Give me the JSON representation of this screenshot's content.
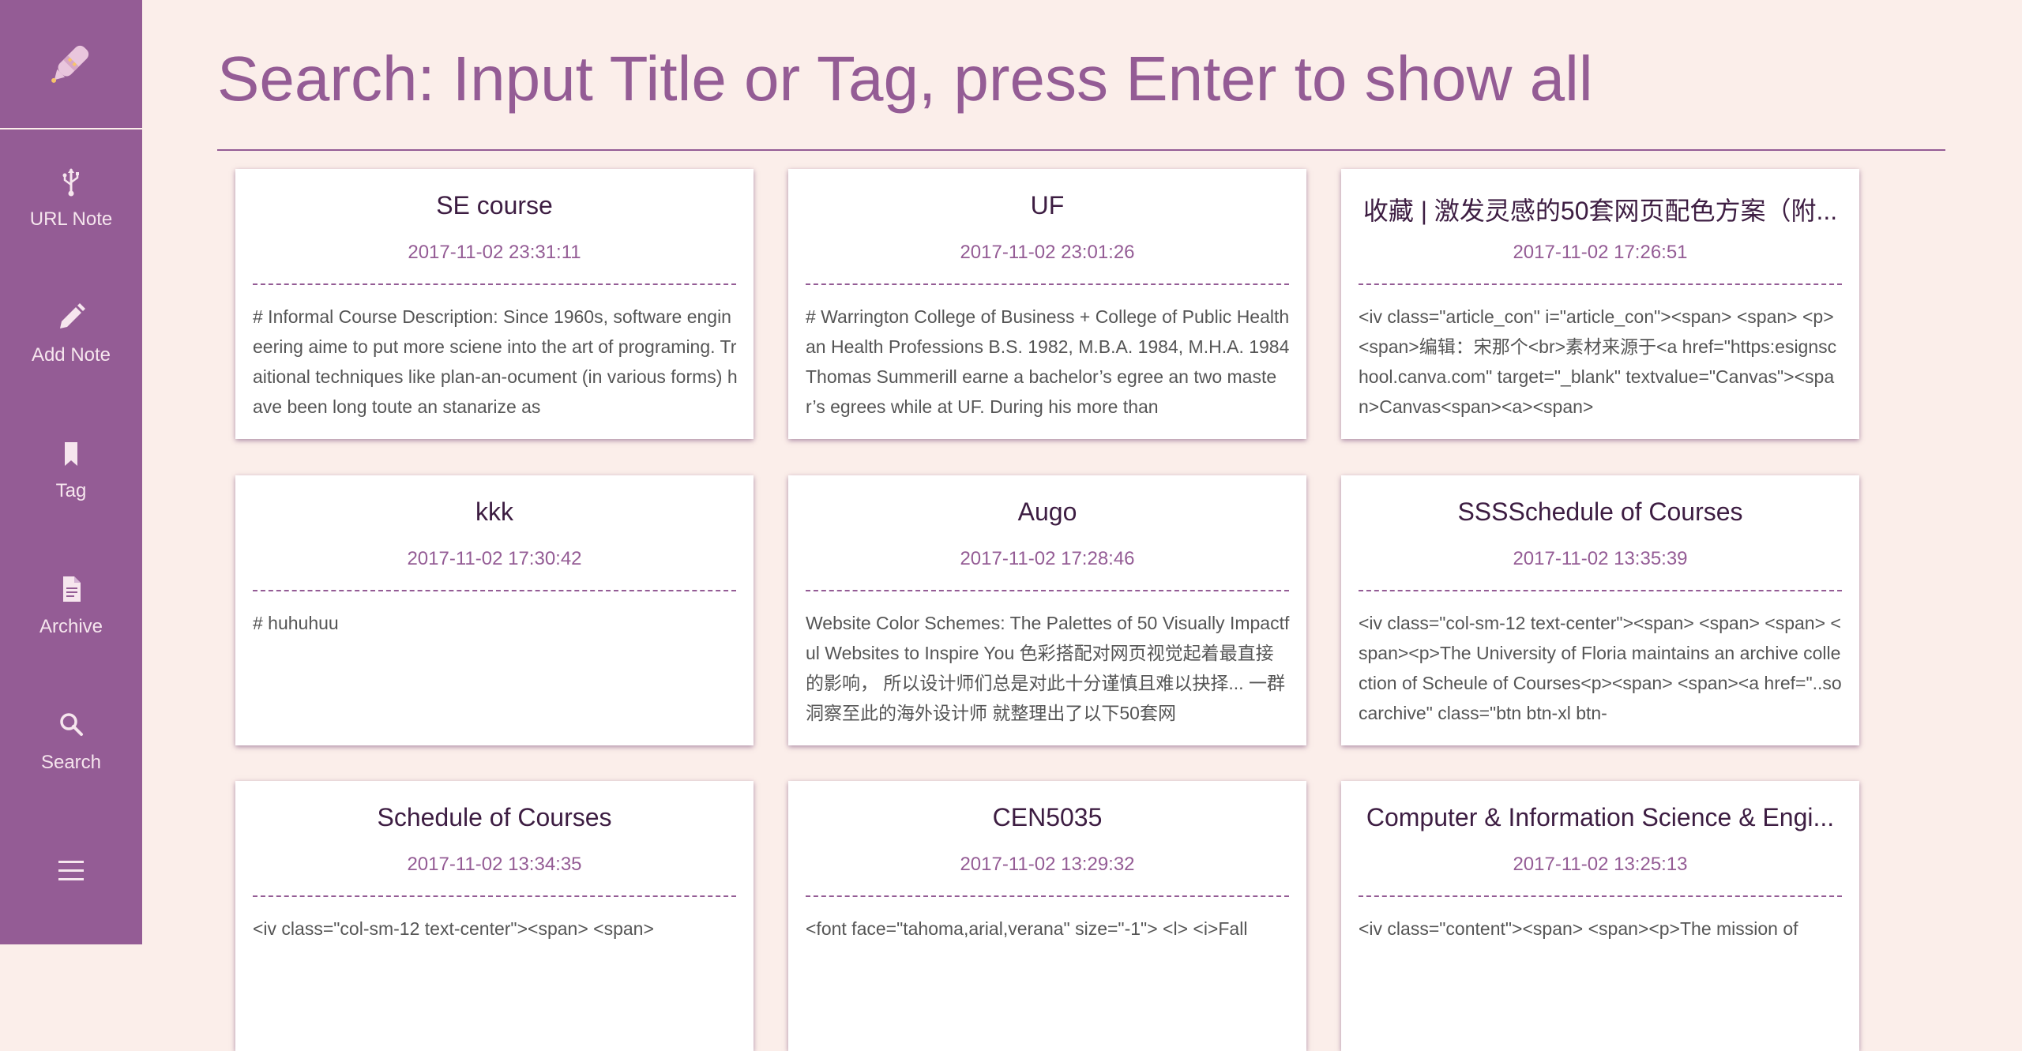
{
  "sidebar": {
    "logo_icon": "pen-icon",
    "items": [
      {
        "label": "URL Note",
        "icon": "usb-icon"
      },
      {
        "label": "Add Note",
        "icon": "pencil-icon"
      },
      {
        "label": "Tag",
        "icon": "bookmark-icon"
      },
      {
        "label": "Archive",
        "icon": "document-icon"
      },
      {
        "label": "Search",
        "icon": "search-icon"
      }
    ],
    "menu_icon": "hamburger-menu-icon"
  },
  "header": {
    "title": "Search: Input Title or Tag, press Enter to show all"
  },
  "colors": {
    "background": "#fbeeea",
    "sidebar": "#945c95",
    "accent": "#945c95",
    "card_title": "#3d1d42",
    "card_body": "#555555"
  },
  "notes": [
    {
      "title": "SE course",
      "date": "2017-11-02 23:31:11",
      "preview": "# Informal Course Description: Since 1960s, software engineering aime to put more sciene into the art of programing. Traitional techniques like plan-an-ocument (in various forms) have been long toute an stanarize as"
    },
    {
      "title": "UF",
      "date": "2017-11-02 23:01:26",
      "preview": "# Warrington College of Business + College of Public Health an Health Professions B.S. 1982, M.B.A. 1984, M.H.A. 1984 Thomas Summerill earne a bachelor’s egree an two master’s egrees while at UF. During his more than"
    },
    {
      "title": "收藏 | 激发灵感的50套网页配色方案（附...",
      "date": "2017-11-02 17:26:51",
      "preview": "<iv class=\"article_con\" i=\"article_con\"><span> <span> <p><span>编辑：宋那个<br>素材来源于<a href=\"https:esignschool.canva.com\" target=\"_blank\" textvalue=\"Canvas\"><span>Canvas<span><a><span>"
    },
    {
      "title": "kkk",
      "date": "2017-11-02 17:30:42",
      "preview": "# huhuhuu"
    },
    {
      "title": "Augo",
      "date": "2017-11-02 17:28:46",
      "preview": "Website Color Schemes: The Palettes of 50 Visually Impactful Websites to Inspire You 色彩搭配对网页视觉起着最直接的影响， 所以设计师们总是对此十分谨慎且难以抉择... 一群洞察至此的海外设计师 就整理出了以下50套网"
    },
    {
      "title": "SSSSchedule of Courses",
      "date": "2017-11-02 13:35:39",
      "preview": "<iv class=\"col-sm-12 text-center\"><span> <span> <span> <span><p>The University of Floria maintains an archive collection of Scheule of Courses<p><span> <span><a href=\"..socarchive\" class=\"btn btn-xl btn-"
    },
    {
      "title": "Schedule of Courses",
      "date": "2017-11-02 13:34:35",
      "preview": "<iv class=\"col-sm-12 text-center\"><span> <span>"
    },
    {
      "title": "CEN5035",
      "date": "2017-11-02 13:29:32",
      "preview": "<font face=\"tahoma,arial,verana\" size=\"-1\"> <l> <i>Fall"
    },
    {
      "title": "Computer & Information Science & Engi...",
      "date": "2017-11-02 13:25:13",
      "preview": "<iv class=\"content\"><span> <span><p>The mission of"
    }
  ]
}
